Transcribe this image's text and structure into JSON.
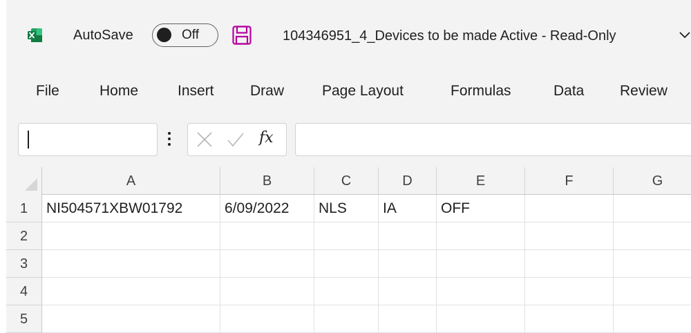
{
  "titlebar": {
    "autosave_label": "AutoSave",
    "autosave_state": "Off",
    "document_title": "104346951_4_Devices to be made Active  -  Read-Only"
  },
  "ribbon": {
    "tabs": [
      "File",
      "Home",
      "Insert",
      "Draw",
      "Page Layout",
      "Formulas",
      "Data",
      "Review"
    ]
  },
  "formula_bar": {
    "name_box_value": "",
    "fx_label": "fx",
    "formula_value": ""
  },
  "sheet": {
    "columns": [
      "A",
      "B",
      "C",
      "D",
      "E",
      "F",
      "G"
    ],
    "rows": [
      "1",
      "2",
      "3",
      "4",
      "5"
    ],
    "cells": [
      [
        "NI504571XBW01792",
        "6/09/2022",
        "NLS",
        "IA",
        "OFF",
        "",
        ""
      ],
      [
        "",
        "",
        "",
        "",
        "",
        "",
        ""
      ],
      [
        "",
        "",
        "",
        "",
        "",
        "",
        ""
      ],
      [
        "",
        "",
        "",
        "",
        "",
        "",
        ""
      ],
      [
        "",
        "",
        "",
        "",
        "",
        "",
        ""
      ]
    ]
  },
  "colors": {
    "excel_green": "#107c41",
    "save_icon": "#b4009e",
    "chrome_background": "#f3f3f3"
  },
  "icons": [
    "excel-logo-icon",
    "save-icon",
    "chevron-down-icon",
    "more-options-icon",
    "cancel-icon",
    "enter-check-icon",
    "insert-function-icon"
  ]
}
